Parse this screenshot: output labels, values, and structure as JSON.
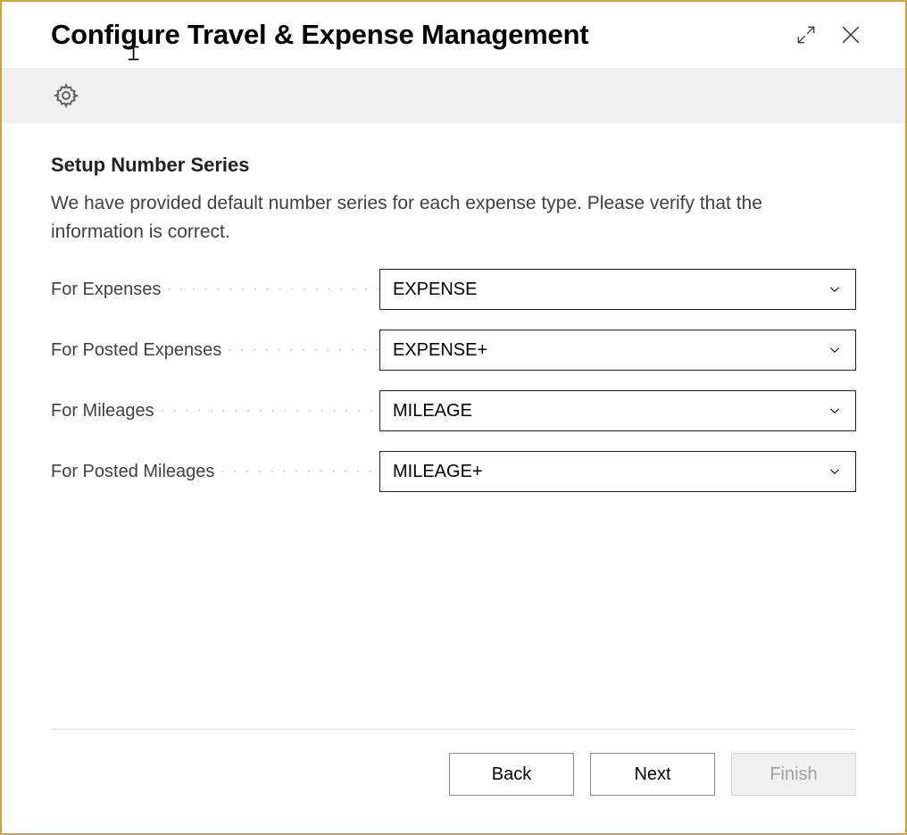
{
  "window": {
    "title": "Configure Travel & Expense Management"
  },
  "section": {
    "title": "Setup Number Series",
    "description": "We have provided default number series for each expense type. Please verify that the information is correct."
  },
  "fields": {
    "expenses": {
      "label": "For Expenses",
      "value": "EXPENSE"
    },
    "posted_expenses": {
      "label": "For Posted Expenses",
      "value": "EXPENSE+"
    },
    "mileages": {
      "label": "For Mileages",
      "value": "MILEAGE"
    },
    "posted_mileages": {
      "label": "For Posted Mileages",
      "value": "MILEAGE+"
    }
  },
  "buttons": {
    "back": "Back",
    "next": "Next",
    "finish": "Finish"
  }
}
